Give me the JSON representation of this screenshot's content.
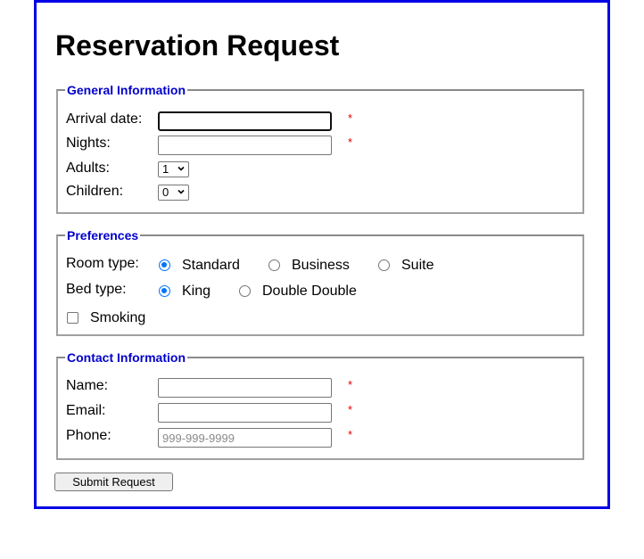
{
  "title": "Reservation Request",
  "general": {
    "legend": "General Information",
    "arrival_label": "Arrival date:",
    "arrival_value": "",
    "nights_label": "Nights:",
    "nights_value": "",
    "adults_label": "Adults:",
    "adults_value": "1",
    "children_label": "Children:",
    "children_value": "0",
    "required_mark": "*"
  },
  "preferences": {
    "legend": "Preferences",
    "room_label": "Room type:",
    "room_options": [
      "Standard",
      "Business",
      "Suite"
    ],
    "room_selected": "Standard",
    "bed_label": "Bed type:",
    "bed_options": [
      "King",
      "Double Double"
    ],
    "bed_selected": "King",
    "smoking_label": "Smoking",
    "smoking_checked": false
  },
  "contact": {
    "legend": "Contact Information",
    "name_label": "Name:",
    "name_value": "",
    "email_label": "Email:",
    "email_value": "",
    "phone_label": "Phone:",
    "phone_value": "",
    "phone_placeholder": "999-999-9999",
    "required_mark": "*"
  },
  "submit_label": "Submit Request",
  "colors": {
    "frame_border": "#0000e6",
    "legend_text": "#0000cc",
    "required": "#e00000",
    "radio_accent": "#0075ff"
  }
}
